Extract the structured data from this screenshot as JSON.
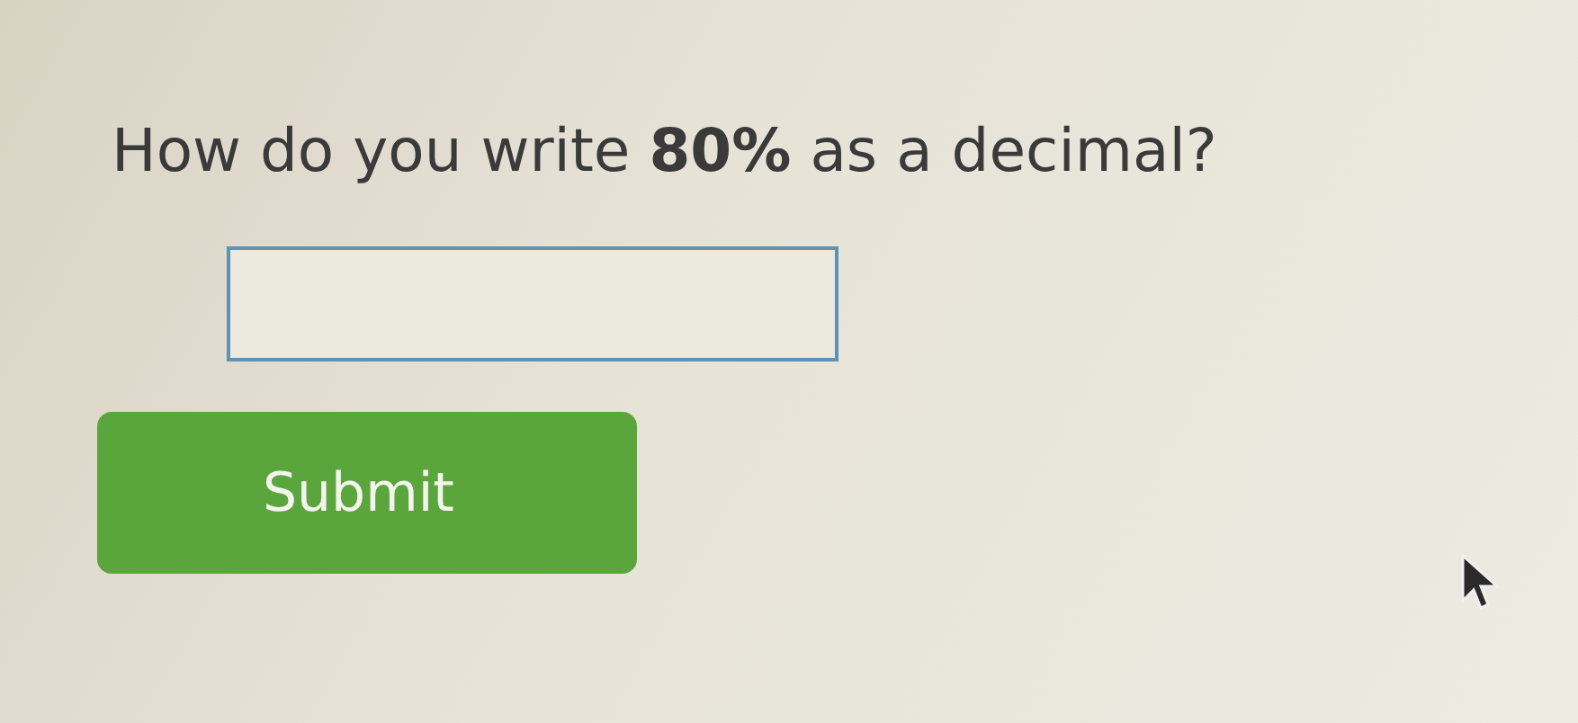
{
  "question": "How do you write **80%** as a decimal?",
  "submit_button": {
    "label": "Submit"
  }
}
